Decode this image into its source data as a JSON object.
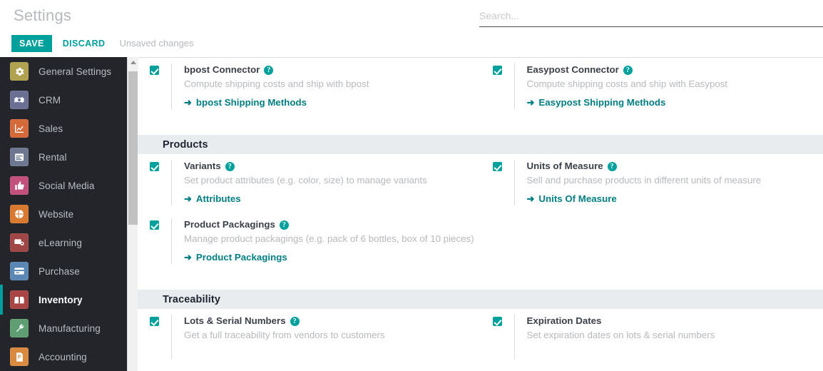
{
  "header": {
    "title": "Settings",
    "save_label": "SAVE",
    "discard_label": "DISCARD",
    "unsaved_label": "Unsaved changes",
    "search_placeholder": "Search...",
    "search_value": ""
  },
  "theme": {
    "accent": "#00A09D",
    "link": "#017e84",
    "sidebar_bg": "#23252b",
    "band_bg": "#e9ecef",
    "muted_text": "#b6b9bd"
  },
  "sidebar": {
    "items": [
      {
        "label": "General Settings",
        "icon": "gear-icon",
        "color": "#b0a24e",
        "active": false
      },
      {
        "label": "CRM",
        "icon": "handshake-icon",
        "color": "#6b6f94",
        "active": false
      },
      {
        "label": "Sales",
        "icon": "chart-line-icon",
        "color": "#d4693a",
        "active": false
      },
      {
        "label": "Rental",
        "icon": "calendar-icon",
        "color": "#6e7790",
        "active": false
      },
      {
        "label": "Social Media",
        "icon": "thumbs-up-icon",
        "color": "#c2517c",
        "active": false
      },
      {
        "label": "Website",
        "icon": "globe-icon",
        "color": "#d9782f",
        "active": false
      },
      {
        "label": "eLearning",
        "icon": "presentation-icon",
        "color": "#a04646",
        "active": false
      },
      {
        "label": "Purchase",
        "icon": "card-icon",
        "color": "#5b87b5",
        "active": false
      },
      {
        "label": "Inventory",
        "icon": "box-icon",
        "color": "#a94545",
        "active": true
      },
      {
        "label": "Manufacturing",
        "icon": "wrench-icon",
        "color": "#5f9e72",
        "active": false
      },
      {
        "label": "Accounting",
        "icon": "invoice-icon",
        "color": "#d98a3f",
        "active": false
      }
    ]
  },
  "sections": [
    {
      "name": "shipping-connectors",
      "title": "",
      "show_band": false,
      "options": [
        {
          "name": "bpost-connector",
          "title": "bpost Connector",
          "has_help": true,
          "description": "Compute shipping costs and ship with bpost",
          "link": "bpost Shipping Methods",
          "checked": true,
          "top_border": true
        },
        {
          "name": "easypost-connector",
          "title": "Easypost Connector",
          "has_help": true,
          "description": "Compute shipping costs and ship with Easypost",
          "link": "Easypost Shipping Methods",
          "checked": true,
          "top_border": true
        }
      ]
    },
    {
      "name": "products",
      "title": "Products",
      "show_band": true,
      "options": [
        {
          "name": "variants",
          "title": "Variants",
          "has_help": true,
          "description": "Set product attributes (e.g. color, size) to manage variants",
          "link": "Attributes",
          "checked": true,
          "top_border": false
        },
        {
          "name": "units-of-measure",
          "title": "Units of Measure",
          "has_help": true,
          "description": "Sell and purchase products in different units of measure",
          "link": "Units Of Measure",
          "checked": true,
          "top_border": false
        },
        {
          "name": "product-packagings",
          "title": "Product Packagings",
          "has_help": true,
          "description": "Manage product packagings (e.g. pack of 6 bottles, box of 10 pieces)",
          "link": "Product Packagings",
          "checked": true,
          "top_border": false
        }
      ]
    },
    {
      "name": "traceability",
      "title": "Traceability",
      "show_band": true,
      "options": [
        {
          "name": "lots-serial-numbers",
          "title": "Lots & Serial Numbers",
          "has_help": true,
          "description": "Get a full traceability from vendors to customers",
          "link": "",
          "checked": true,
          "top_border": false
        },
        {
          "name": "expiration-dates",
          "title": "Expiration Dates",
          "has_help": false,
          "description": "Set expiration dates on lots & serial numbers",
          "link": "",
          "checked": true,
          "top_border": false
        }
      ]
    }
  ],
  "icons": {
    "help_glyph": "?",
    "link_arrow": "➜"
  }
}
